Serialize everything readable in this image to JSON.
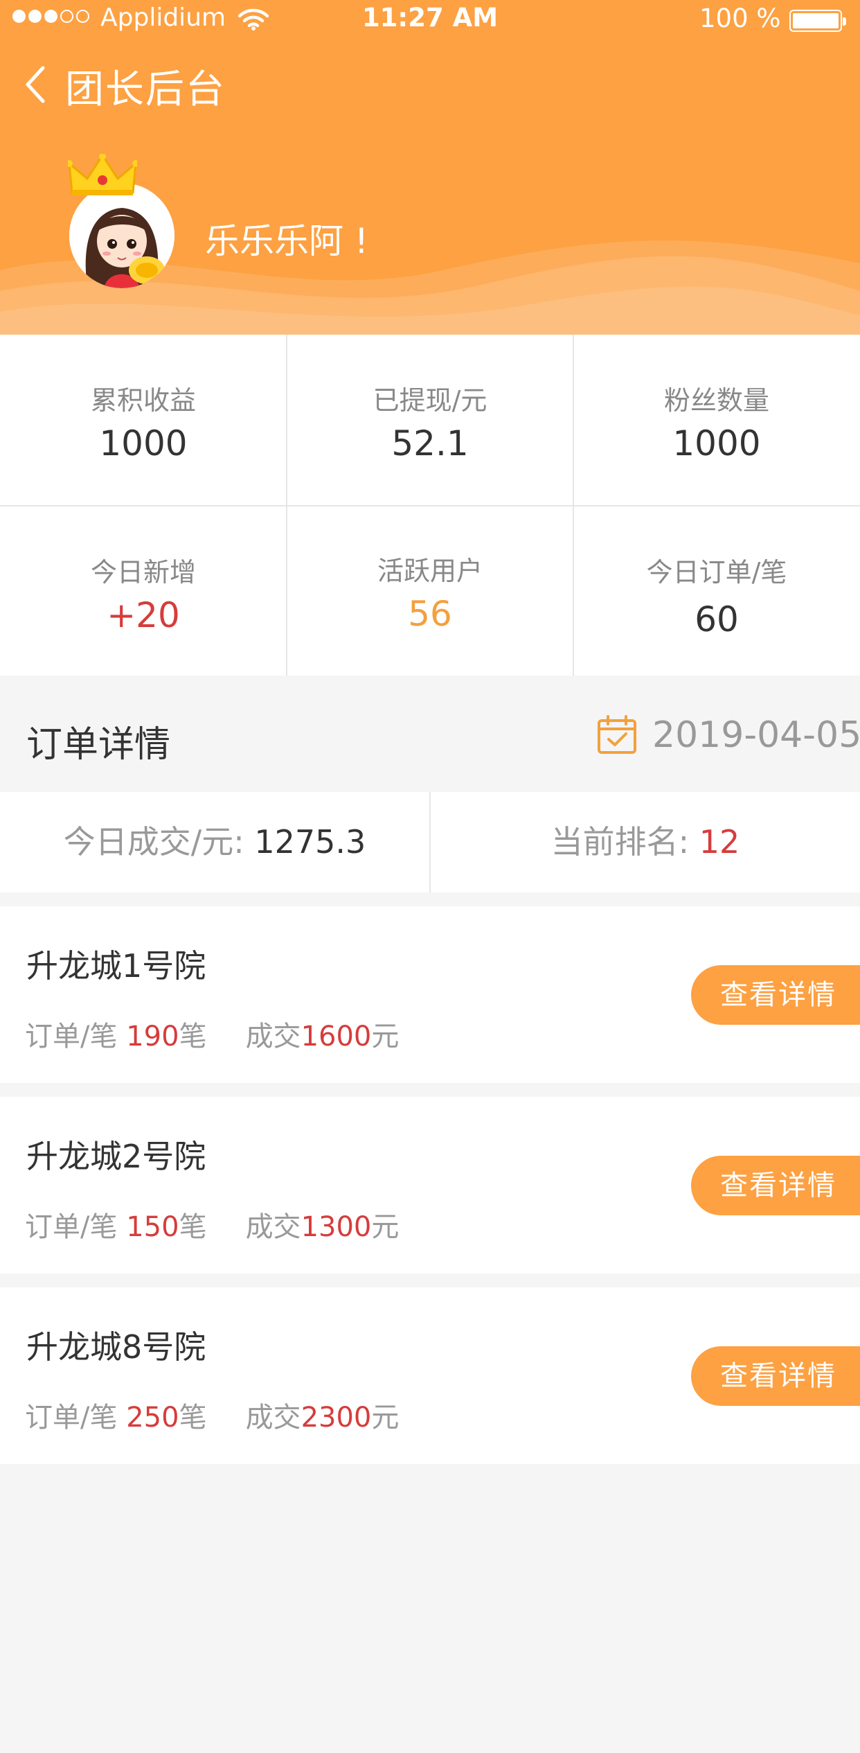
{
  "status_bar": {
    "carrier": "Applidium",
    "time": "11:27 AM",
    "battery": "100 %"
  },
  "nav": {
    "title": "团长后台"
  },
  "profile": {
    "username": "乐乐乐阿 !"
  },
  "stats": [
    {
      "label": "累积收益",
      "value": "1000"
    },
    {
      "label": "已提现/元",
      "value": "52.1"
    },
    {
      "label": "粉丝数量",
      "value": "1000"
    },
    {
      "label": "今日新增",
      "value": "+20"
    },
    {
      "label": "活跃用户",
      "value": "56"
    },
    {
      "label": "今日订单/笔",
      "value": "60"
    }
  ],
  "order": {
    "title": "订单详情",
    "date": "2019-04-05",
    "today_label": "今日成交/元:",
    "today_value": "1275.3",
    "rank_label": "当前排名:",
    "rank_value": "12"
  },
  "items": [
    {
      "name": "升龙城1号院",
      "orders_label": "订单/笔",
      "orders": "190",
      "orders_unit": "笔",
      "deal_label": "成交",
      "deal": "1600",
      "deal_unit": "元",
      "button": "查看详情"
    },
    {
      "name": "升龙城2号院",
      "orders_label": "订单/笔",
      "orders": "150",
      "orders_unit": "笔",
      "deal_label": "成交",
      "deal": "1300",
      "deal_unit": "元",
      "button": "查看详情"
    },
    {
      "name": "升龙城8号院",
      "orders_label": "订单/笔",
      "orders": "250",
      "orders_unit": "笔",
      "deal_label": "成交",
      "deal": "2300",
      "deal_unit": "元",
      "button": "查看详情"
    }
  ],
  "colors": {
    "brand": "#fda142",
    "highlight_red": "#d63c3c",
    "highlight_orange": "#f3a03d"
  },
  "icons": {
    "back": "chevron-left-icon",
    "calendar": "calendar-check-icon",
    "crown": "crown-icon",
    "wifi": "wifi-icon",
    "battery": "battery-icon"
  }
}
